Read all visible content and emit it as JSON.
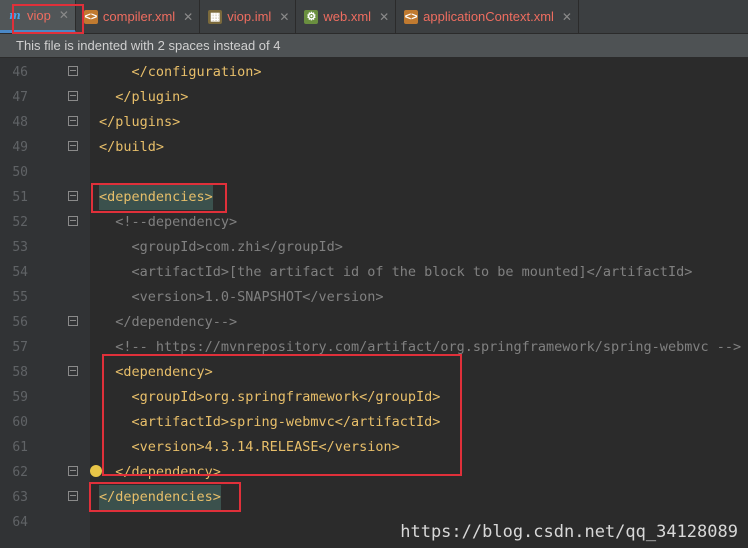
{
  "tabs": [
    {
      "label": "viop",
      "icon": "maven-icon",
      "active": true
    },
    {
      "label": "compiler.xml",
      "icon": "xml-file-icon",
      "active": false
    },
    {
      "label": "viop.iml",
      "icon": "iml-file-icon",
      "active": false
    },
    {
      "label": "web.xml",
      "icon": "web-xml-icon",
      "active": false
    },
    {
      "label": "applicationContext.xml",
      "icon": "xml-file-icon",
      "active": false
    }
  ],
  "notice": "This file is indented with 2 spaces instead of 4",
  "lines": [
    {
      "num": "46",
      "text": "    </configuration>"
    },
    {
      "num": "47",
      "text": "  </plugin>"
    },
    {
      "num": "48",
      "text": "</plugins>"
    },
    {
      "num": "49",
      "text": "</build>"
    },
    {
      "num": "50",
      "text": ""
    },
    {
      "num": "51",
      "text": "<dependencies>"
    },
    {
      "num": "52",
      "text": "  <!--dependency>"
    },
    {
      "num": "53",
      "text": "    <groupId>com.zhi</groupId>"
    },
    {
      "num": "54",
      "text": "    <artifactId>[the artifact id of the block to be mounted]</artifactId>"
    },
    {
      "num": "55",
      "text": "    <version>1.0-SNAPSHOT</version>"
    },
    {
      "num": "56",
      "text": "  </dependency-->"
    },
    {
      "num": "57",
      "text": "  <!-- https://mvnrepository.com/artifact/org.springframework/spring-webmvc -->"
    },
    {
      "num": "58",
      "text": "  <dependency>"
    },
    {
      "num": "59",
      "text": "    <groupId>org.springframework</groupId>"
    },
    {
      "num": "60",
      "text": "    <artifactId>spring-webmvc</artifactId>"
    },
    {
      "num": "61",
      "text": "    <version>4.3.14.RELEASE</version>"
    },
    {
      "num": "62",
      "text": "  </dependency>"
    },
    {
      "num": "63",
      "text": "</dependencies>"
    },
    {
      "num": "64",
      "text": ""
    }
  ],
  "watermark": "https://blog.csdn.net/qq_34128089",
  "colors": {
    "tag": "#e8bf6a",
    "comment": "#808080",
    "text": "#a9b7c6",
    "highlight": "#e0303a"
  }
}
